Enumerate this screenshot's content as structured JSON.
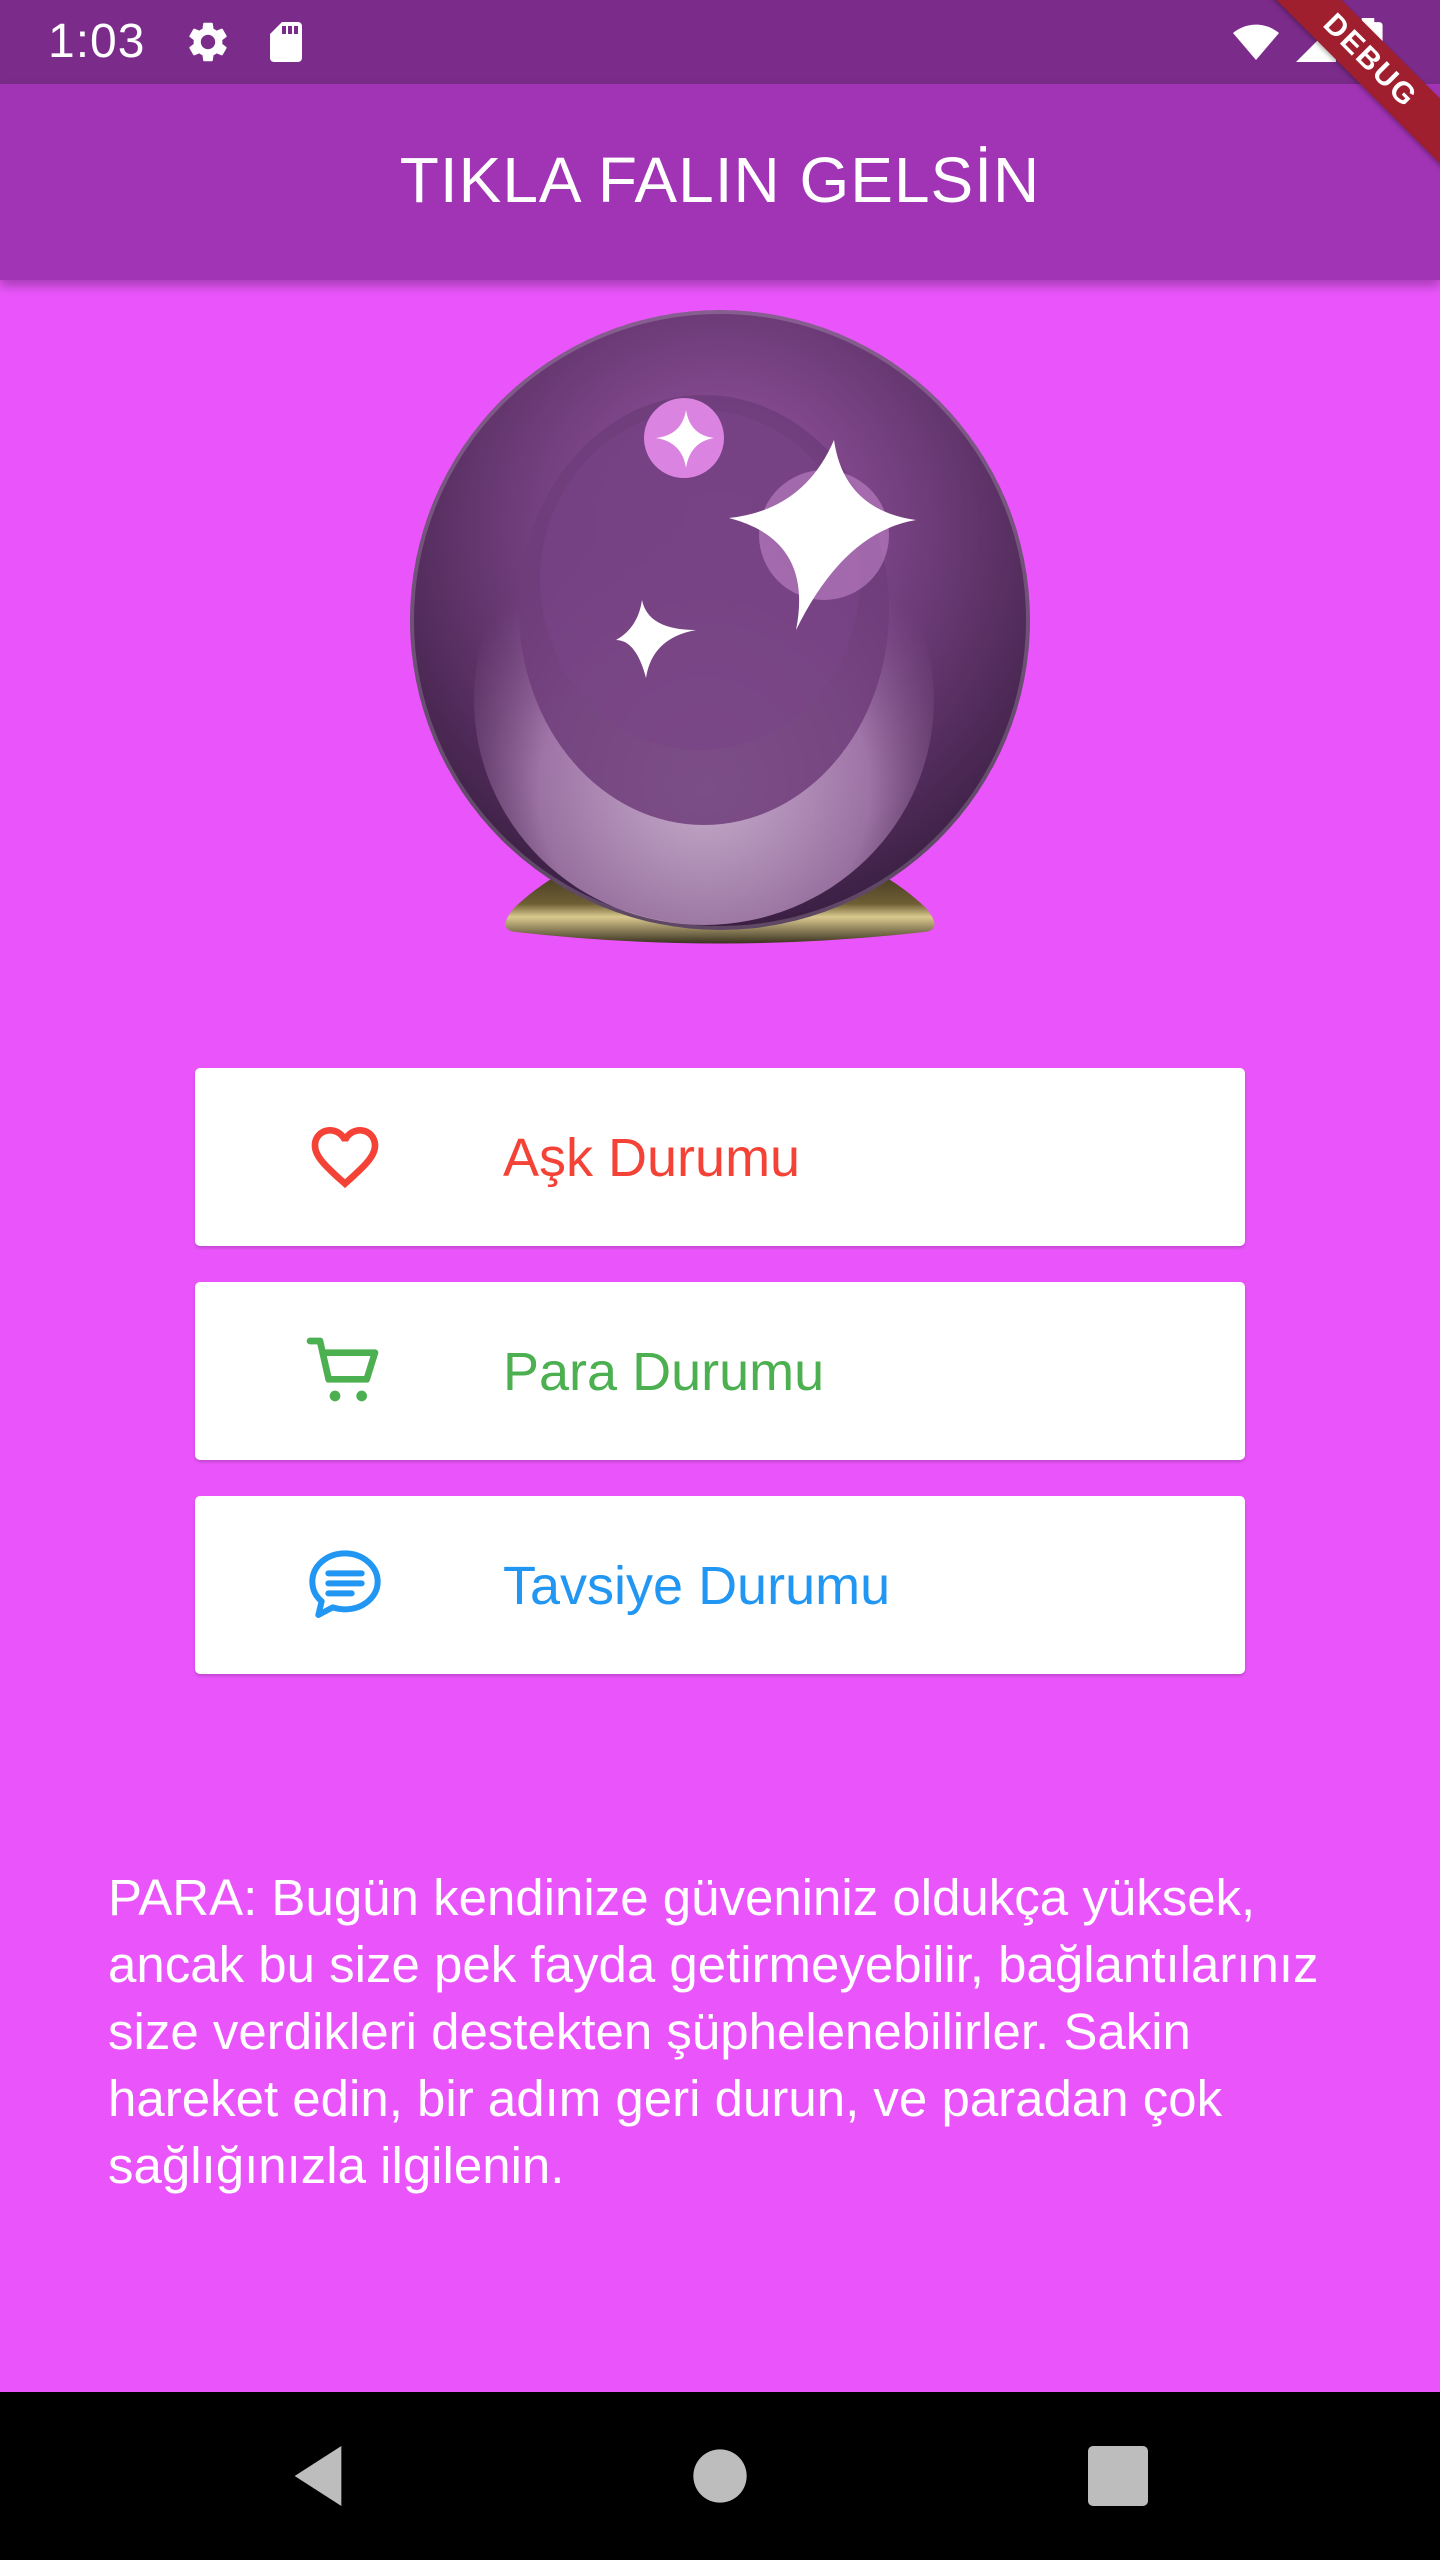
{
  "status_bar": {
    "time": "1:03",
    "icons": [
      "gear-icon",
      "sd-card-icon",
      "wifi-icon",
      "signal-icon",
      "battery-icon"
    ]
  },
  "debug_banner": "DEBUG",
  "app_bar": {
    "title": "TIKLA FALIN GELSİN"
  },
  "hero": {
    "icon": "crystal-ball-icon"
  },
  "buttons": [
    {
      "label": "Aşk Durumu",
      "icon": "heart-icon",
      "color": "#F44336"
    },
    {
      "label": "Para Durumu",
      "icon": "cart-icon",
      "color": "#4CAF50"
    },
    {
      "label": "Tavsiye Durumu",
      "icon": "chat-icon",
      "color": "#2196F3"
    }
  ],
  "fortune": {
    "text": "PARA: Bugün kendinize güveniniz oldukça yüksek, ancak bu size pek fayda getirmeyebilir, bağlantılarınız size verdikleri destekten şüphelenebilirler. Sakin hareket edin, bir adım geri durun, ve paradan çok sağlığınızla ilgilenin."
  },
  "nav_bar": {
    "buttons": [
      "back-icon",
      "home-icon",
      "recents-icon"
    ]
  },
  "colors": {
    "background": "#EA55FB",
    "app_bar": "#A034B5",
    "status_bar": "#7B2B8A"
  }
}
